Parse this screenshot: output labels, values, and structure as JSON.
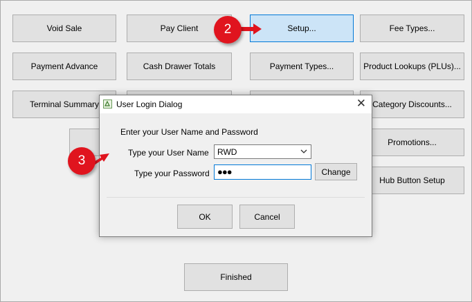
{
  "main_buttons": {
    "void_sale": "Void Sale",
    "pay_client": "Pay Client",
    "setup": "Setup...",
    "fee_types": "Fee Types...",
    "payment_advance": "Payment Advance",
    "cash_drawer_totals": "Cash Drawer Totals",
    "payment_types": "Payment Types...",
    "product_lookups": "Product Lookups (PLUs)...",
    "terminal_summary": "Terminal Summary",
    "category_discounts": "Category Discounts...",
    "promotions": "Promotions...",
    "hub_button_setup": "Hub Button Setup",
    "finished": "Finished"
  },
  "callouts": {
    "step2": "2",
    "step3": "3",
    "color": "#e0141e"
  },
  "dialog": {
    "title": "User Login Dialog",
    "instruction": "Enter your User Name and Password",
    "username_label": "Type your User Name",
    "username_value": "RWD",
    "password_label": "Type your Password",
    "password_value": "●●●",
    "change_button": "Change",
    "ok_button": "OK",
    "cancel_button": "Cancel",
    "close_icon": "close-icon"
  },
  "colors": {
    "highlight_bg": "#cce4f7",
    "highlight_border": "#0078d7",
    "button_bg": "#e1e1e1",
    "window_bg": "#f0f0f0"
  }
}
